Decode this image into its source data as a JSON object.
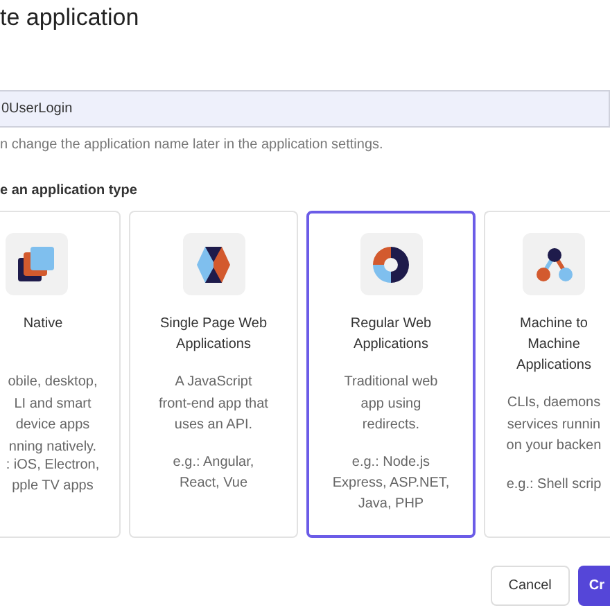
{
  "dialog": {
    "title": "te application"
  },
  "name_field": {
    "value": "0UserLogin"
  },
  "helper_text": "n change the application name later in the application settings.",
  "section_label": "e an application type",
  "app_types": [
    {
      "title": "Native",
      "description": "obile, desktop,\nLI and smart\ndevice apps\nnning natively.",
      "examples": ": iOS, Electron,\npple TV apps",
      "selected": false
    },
    {
      "title": "Single Page Web\nApplications",
      "description": "A JavaScript\nfront-end app that\nuses an API.",
      "examples": "e.g.: Angular,\nReact, Vue",
      "selected": false
    },
    {
      "title": "Regular Web\nApplications",
      "description": "Traditional web\napp using\nredirects.",
      "examples": "e.g.: Node.js\nExpress, ASP.NET,\nJava, PHP",
      "selected": true
    },
    {
      "title": "Machine to\nMachine\nApplications",
      "description": "CLIs, daemons\nservices runnin\non your backen",
      "examples": "e.g.: Shell scrip",
      "selected": false
    }
  ],
  "buttons": [
    {
      "label": "Cancel",
      "kind": "secondary"
    },
    {
      "label": "Cr",
      "kind": "primary"
    }
  ]
}
